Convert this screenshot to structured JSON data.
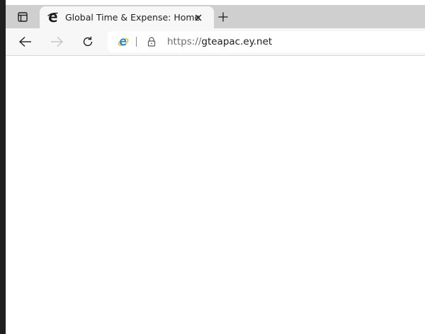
{
  "tab": {
    "title": "Global Time & Expense: Home",
    "favicon": "edge-legacy-e-icon"
  },
  "address_bar": {
    "url_scheme": "https://",
    "url_host": "gteapac.ey.net",
    "site_icon": "internet-explorer-mode-icon",
    "security_icon": "lock-icon"
  },
  "navigation": {
    "back": "back-arrow-icon",
    "forward": "forward-arrow-icon",
    "refresh": "refresh-icon"
  },
  "colors": {
    "titlebar": "#cfcfcf",
    "toolbar": "#f7f7f7",
    "content": "#ffffff",
    "ie_blue": "#1e88d6",
    "ie_ring": "#f4b400"
  }
}
